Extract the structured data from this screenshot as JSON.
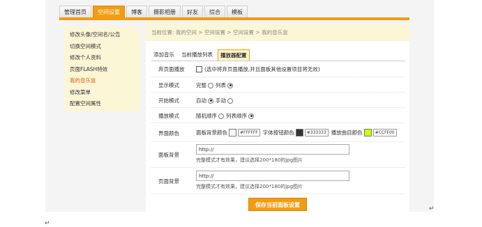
{
  "top_nav": {
    "tabs": [
      {
        "label": "管理首页"
      },
      {
        "label": "空间设置",
        "active": true
      },
      {
        "label": "博客"
      },
      {
        "label": "摄影相册"
      },
      {
        "label": "好友"
      },
      {
        "label": "综合"
      },
      {
        "label": "模板"
      }
    ]
  },
  "sidebar": {
    "items": [
      {
        "label": "修改头像/空间名/公告"
      },
      {
        "label": "切换空间模式"
      },
      {
        "label": "修改个人资料"
      },
      {
        "label": "页面FLASH特效"
      },
      {
        "label": "我的音乐盒",
        "active": true
      },
      {
        "label": "修改菜单"
      },
      {
        "label": "配置空间属性"
      }
    ]
  },
  "breadcrumb": "当前位置: 我的空间 > 空间设置 > 空间设置 > 我的音乐盒",
  "subtabs": [
    {
      "label": "添加音乐"
    },
    {
      "label": "当前播放列表"
    },
    {
      "label": "播放器配置",
      "active": true
    }
  ],
  "form": {
    "disable": {
      "label": "弃页面播放",
      "text": "(选中将弃页面播放,并且面板其他设置项目将无效)"
    },
    "display_mode": {
      "label": "显示模式",
      "opt1": "完整",
      "opt2": "列表",
      "selected": 2
    },
    "start_mode": {
      "label": "开始模式",
      "opt1": "自动",
      "opt2": "手动",
      "selected": 1
    },
    "play_order": {
      "label": "播放模式",
      "opt1": "随机顺序",
      "opt2": "列表顺序",
      "selected": 2
    },
    "colors": {
      "label": "界面颜色",
      "bg_label": "面板背景颜色",
      "bg_value": "#FFFFFF",
      "btn_label": "字体按钮颜色",
      "btn_value": "#333333",
      "track_label": "播放曲目颜色",
      "track_value": "#CCFF00"
    },
    "panel_bg": {
      "label": "面板背景",
      "value": "http://",
      "hint": "完整模式才有效果，建议选择200*180的jpg图片"
    },
    "page_bg": {
      "label": "页面背景",
      "value": "http://",
      "hint": "完整模式才有效果，建议选择200*180的jpg图片"
    },
    "save_label": "保存当前面板设置"
  },
  "paragraph_mark": "↵"
}
